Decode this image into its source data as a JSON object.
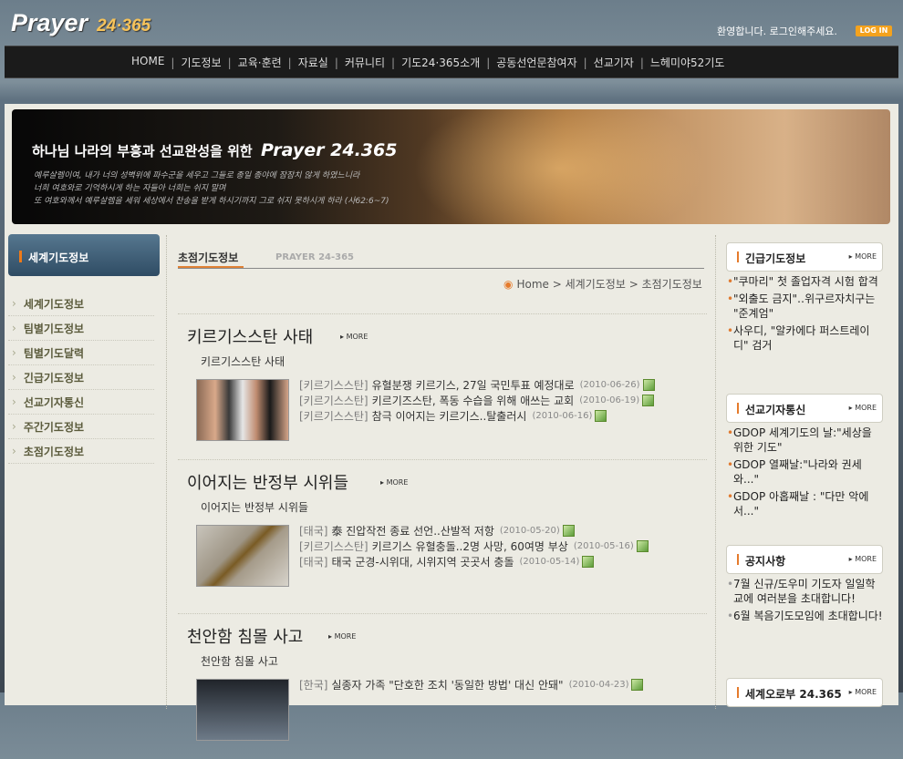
{
  "header": {
    "logo_main": "Prayer",
    "logo_sub": "24·365",
    "welcome": "환영합니다. 로그인해주세요.",
    "login_label": "LOG IN"
  },
  "nav": [
    "HOME",
    "기도정보",
    "교육·훈련",
    "자료실",
    "커뮤니티",
    "기도24·365소개",
    "공동선언문참여자",
    "선교기자",
    "느헤미야52기도"
  ],
  "banner": {
    "tagline": "하나님 나라의 부흥과 선교완성을 위한",
    "brand": "Prayer 24.365",
    "verse": [
      "예루살렘이여, 내가 너의 성벽위에 파수군을 세우고 그들로 종일 종야에 잠잠치 않게 하였느니라",
      "너희 여호와로 기억하시게 하는 자들아 너희는 쉬지 말며",
      "또 여호와께서 예루살렘을 세워 세상에서 찬송을 받게 하시기까지 그로 쉬지 못하시게 하라 (사62:6~7)"
    ]
  },
  "sidebar": {
    "title": "세계기도정보",
    "items": [
      "세계기도정보",
      "팀별기도정보",
      "팀별기도달력",
      "긴급기도정보",
      "선교기자통신",
      "주간기도정보",
      "초점기도정보"
    ]
  },
  "main": {
    "title": "초점기도정보",
    "subtitle": "PRAYER 24-365",
    "breadcrumb": [
      "Home",
      "세계기도정보",
      "초점기도정보"
    ],
    "more_label": "MORE",
    "sections": [
      {
        "title": "키르기스스탄 사태",
        "subtitle": "키르기스스탄 사태",
        "news": [
          {
            "category": "[키르기스스탄]",
            "text": "유혈분쟁 키르기스, 27일 국민투표 예정대로",
            "date": "(2010-06-26)"
          },
          {
            "category": "[키르기스스탄]",
            "text": "키르기즈스탄, 폭동 수습을 위해 애쓰는 교회",
            "date": "(2010-06-19)"
          },
          {
            "category": "[키르기스스탄]",
            "text": "참극 이어지는 키르기스..탈출러시",
            "date": "(2010-06-16)"
          }
        ]
      },
      {
        "title": "이어지는 반정부 시위들",
        "subtitle": "이어지는 반정부 시위들",
        "news": [
          {
            "category": "[태국]",
            "text": "泰 진압작전 종료 선언..산발적 저항",
            "date": "(2010-05-20)"
          },
          {
            "category": "[키르기스스탄]",
            "text": "키르기스 유혈충돌..2명 사망, 60여명 부상",
            "date": "(2010-05-16)"
          },
          {
            "category": "[태국]",
            "text": "태국 군경-시위대, 시위지역 곳곳서 충돌",
            "date": "(2010-05-14)"
          }
        ]
      },
      {
        "title": "천안함 침몰 사고",
        "subtitle": "천안함 침몰 사고",
        "news": [
          {
            "category": "[한국]",
            "text": "실종자 가족 \"단호한 조치 '동일한 방법' 대신 안돼\"",
            "date": "(2010-04-23)"
          }
        ]
      }
    ]
  },
  "right": [
    {
      "title": "긴급기도정보",
      "items": [
        "\"쿠마리\" 첫 졸업자격 시험 합격",
        "\"외출도 금지\"‥위구르자치구는 \"준계엄\"",
        "사우디, \"알카에다 퍼스트레이디\" 검거"
      ]
    },
    {
      "title": "선교기자통신",
      "items": [
        "GDOP 세계기도의 날:\"세상을 위한 기도\"",
        "GDOP 열째날:\"나라와 권세와...\"",
        "GDOP 아홉째날 : \"다만 악에서...\""
      ]
    },
    {
      "title": "공지사항",
      "items": [
        "7월 신규/도우미 기도자 일일학교에 여러분을 초대합니다!",
        "6월 복음기도모임에 초대합니다!"
      ]
    },
    {
      "title": "세계오로부 24.365",
      "items": []
    }
  ],
  "colors": {
    "accent": "#e57b2c",
    "nav_bg": "#1b1b1b",
    "sidebar_head": "#3f5f78",
    "content_bg": "#ecebe3"
  }
}
